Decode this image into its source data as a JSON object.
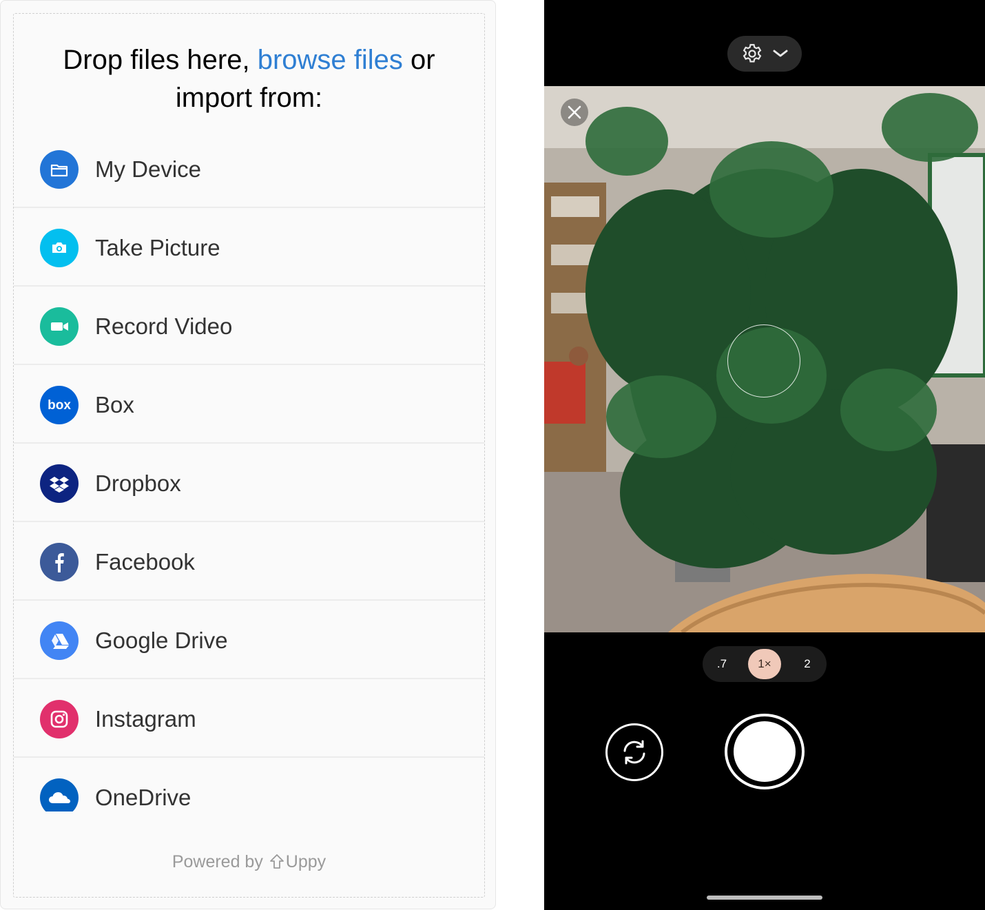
{
  "uppy": {
    "title_part1": "Drop files here, ",
    "browse_link": "browse files",
    "title_part2": " or import from:",
    "providers": [
      {
        "label": "My Device",
        "icon": "folder-icon",
        "color": "#2275d7"
      },
      {
        "label": "Take Picture",
        "icon": "camera-icon",
        "color": "#03bfef"
      },
      {
        "label": "Record Video",
        "icon": "video-camera-icon",
        "color": "#1abc9c"
      },
      {
        "label": "Box",
        "icon": "box-logo-icon",
        "color": "#0061d5"
      },
      {
        "label": "Dropbox",
        "icon": "dropbox-logo-icon",
        "color": "#0d2481"
      },
      {
        "label": "Facebook",
        "icon": "facebook-logo-icon",
        "color": "#3c5a99"
      },
      {
        "label": "Google Drive",
        "icon": "google-drive-logo-icon",
        "color": "#4285f4"
      },
      {
        "label": "Instagram",
        "icon": "instagram-logo-icon",
        "color": "#e1306c"
      },
      {
        "label": "OneDrive",
        "icon": "onedrive-logo-icon",
        "color": "#0262c0"
      }
    ],
    "powered_by": "Powered by",
    "brand": "Uppy"
  },
  "camera": {
    "zoom_options": [
      ".7",
      "1×",
      "2"
    ],
    "active_zoom": "1×"
  }
}
